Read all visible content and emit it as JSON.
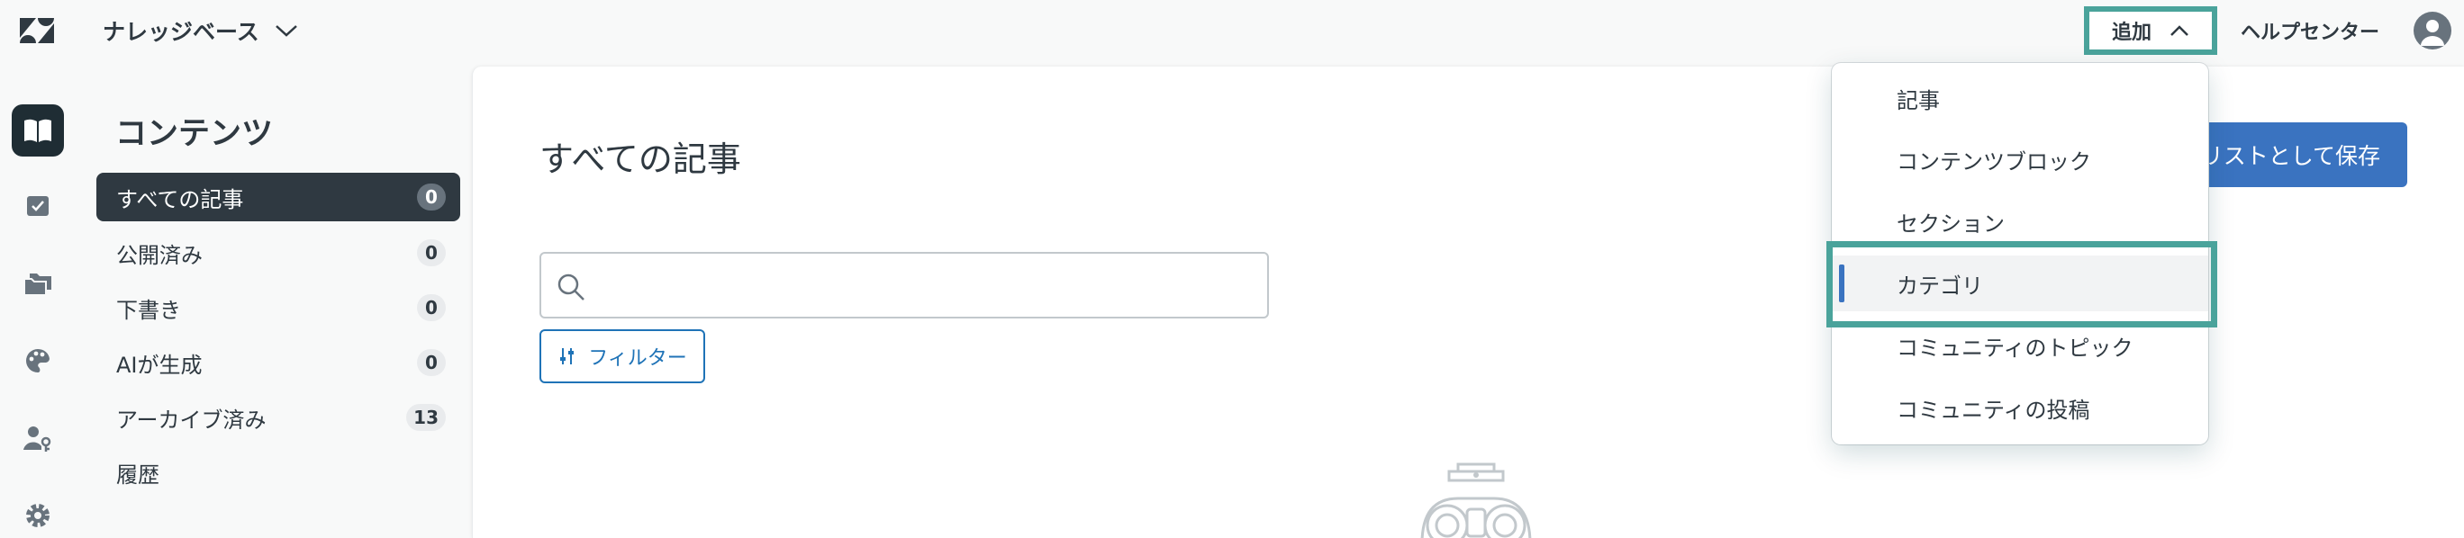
{
  "topbar": {
    "product_name": "ナレッジベース",
    "add_label": "追加",
    "help_center_label": "ヘルプセンター"
  },
  "rail": {
    "items": [
      {
        "name": "knowledge-base-icon",
        "active": true
      },
      {
        "name": "review-icon"
      },
      {
        "name": "folders-icon"
      },
      {
        "name": "palette-icon"
      },
      {
        "name": "user-permissions-icon"
      },
      {
        "name": "settings-icon"
      }
    ]
  },
  "subnav": {
    "title": "コンテンツ",
    "items": [
      {
        "label": "すべての記事",
        "count": "0"
      },
      {
        "label": "公開済み",
        "count": "0"
      },
      {
        "label": "下書き",
        "count": "0"
      },
      {
        "label": "AIが生成",
        "count": "0"
      },
      {
        "label": "アーカイブ済み",
        "count": "13"
      },
      {
        "label": "履歴",
        "count": ""
      }
    ]
  },
  "main": {
    "title": "すべての記事",
    "save_label": "リストとして保存",
    "search_placeholder": "",
    "filter_label": "フィルター"
  },
  "dropdown": {
    "items": [
      {
        "label": "記事"
      },
      {
        "label": "コンテンツブロック"
      },
      {
        "label": "セクション"
      },
      {
        "label": "カテゴリ",
        "focused": true
      },
      {
        "label": "コミュニティのトピック"
      },
      {
        "label": "コミュニティの投稿"
      }
    ]
  },
  "colors": {
    "accent": "#3a73c0",
    "annotation": "#4aa39b",
    "dark": "#2f3941"
  }
}
